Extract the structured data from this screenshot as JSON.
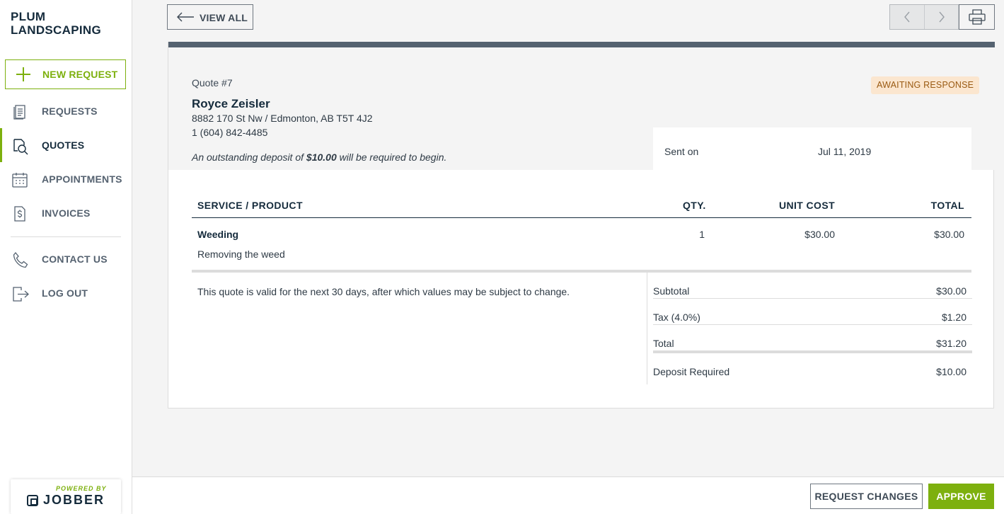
{
  "brand": {
    "line1": "PLUM",
    "line2": "LANDSCAPING"
  },
  "sidebar": {
    "new_request": "NEW REQUEST",
    "items": [
      {
        "label": "REQUESTS",
        "icon": "clipboard-list-icon"
      },
      {
        "label": "QUOTES",
        "icon": "magnifier-quote-icon",
        "active": true
      },
      {
        "label": "APPOINTMENTS",
        "icon": "calendar-icon"
      },
      {
        "label": "INVOICES",
        "icon": "invoice-dollar-icon"
      },
      {
        "label": "CONTACT US",
        "icon": "phone-icon"
      },
      {
        "label": "LOG OUT",
        "icon": "logout-icon"
      }
    ],
    "powered_by": "POWERED BY",
    "powered_brand": "JOBBER"
  },
  "toolbar": {
    "view_all": "VIEW ALL"
  },
  "quote": {
    "number": "Quote #7",
    "status": "AWAITING RESPONSE",
    "client_name": "Royce Zeisler",
    "address": "8882 170 St Nw / Edmonton, AB T5T 4J2",
    "phone": "1 (604) 842-4485",
    "deposit_note_pre": "An outstanding deposit of",
    "deposit_note_amount": "$10.00",
    "deposit_note_post": "will be required to begin.",
    "sent_on_label": "Sent on",
    "sent_on_value": "Jul 11, 2019",
    "columns": {
      "service": "SERVICE / PRODUCT",
      "qty": "QTY.",
      "unit_cost": "UNIT COST",
      "total": "TOTAL"
    },
    "line_items": [
      {
        "name": "Weeding",
        "description": "Removing the weed",
        "qty": "1",
        "unit_cost": "$30.00",
        "total": "$30.00"
      }
    ],
    "validity_note": "This quote is valid for the next 30 days, after which values may be subject to change.",
    "totals": {
      "subtotal_label": "Subtotal",
      "subtotal": "$30.00",
      "tax_label": "Tax (4.0%)",
      "tax": "$1.20",
      "total_label": "Total",
      "total": "$31.20",
      "deposit_label": "Deposit Required",
      "deposit": "$10.00"
    }
  },
  "actions": {
    "request_changes": "REQUEST CHANGES",
    "approve": "APPROVE"
  },
  "colors": {
    "accent": "#7db00e",
    "navy": "#152b3c",
    "status_bg": "#fbe6cf",
    "status_text": "#9a5a12"
  }
}
